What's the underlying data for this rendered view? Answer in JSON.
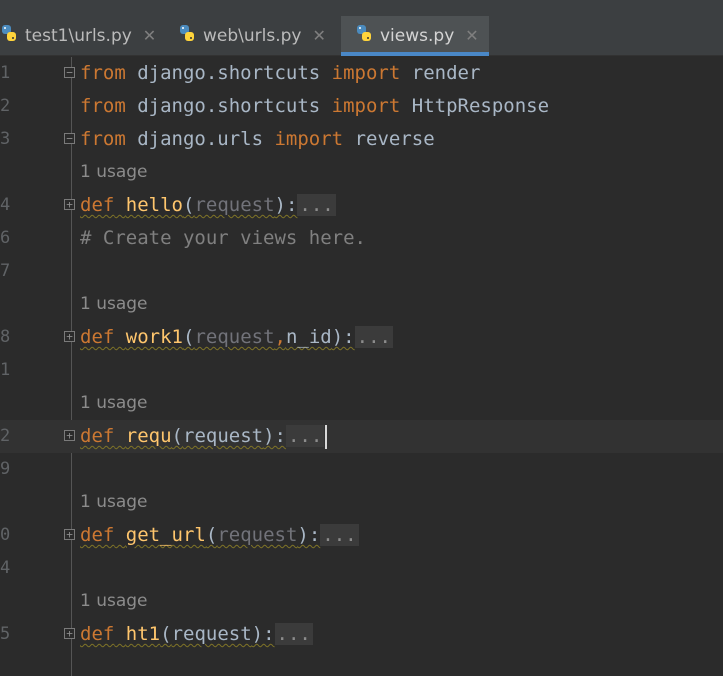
{
  "tabs": [
    {
      "label": "test1\\urls.py",
      "active": false
    },
    {
      "label": "web\\urls.py",
      "active": false
    },
    {
      "label": "views.py",
      "active": true
    }
  ],
  "close_glyph": "✕",
  "usage_label": "1 usage",
  "code": {
    "line1": {
      "num": "1",
      "kw": "from",
      "mod": " django.shortcuts ",
      "kw2": "import",
      "name": " render"
    },
    "line2": {
      "num": "2",
      "kw": "from",
      "mod": " django.shortcuts ",
      "kw2": "import",
      "name": " HttpResponse"
    },
    "line3": {
      "num": "3",
      "kw": "from",
      "mod": " django.urls ",
      "kw2": "import",
      "name": " reverse"
    },
    "hello": {
      "num": "4",
      "kw": "def",
      "fn": "hello",
      "open": "(",
      "p1": "request",
      "close": "):",
      "dots": "..."
    },
    "comment": {
      "num": "6",
      "text": "# Create your views here."
    },
    "blank7": {
      "num": "7"
    },
    "work1": {
      "num": "8",
      "kw": "def",
      "fn": "work1",
      "open": "(",
      "p1": "request",
      "comma": ",",
      "p2": "n_id",
      "close": "):",
      "dots": "..."
    },
    "blank1": {
      "num": "1"
    },
    "requ": {
      "num": "2",
      "kw": "def",
      "fn": "requ",
      "open": "(",
      "p1": "request",
      "close": "):",
      "dots": "..."
    },
    "blank9": {
      "num": "9"
    },
    "get_url": {
      "num": "0",
      "kw": "def",
      "fn": "get_url",
      "open": "(",
      "p1": "request",
      "close": "):",
      "dots": "..."
    },
    "blank4": {
      "num": "4"
    },
    "ht1": {
      "num": "5",
      "kw": "def",
      "fn": "ht1",
      "open": "(",
      "p1": "request",
      "close": "):",
      "dots": "..."
    }
  }
}
